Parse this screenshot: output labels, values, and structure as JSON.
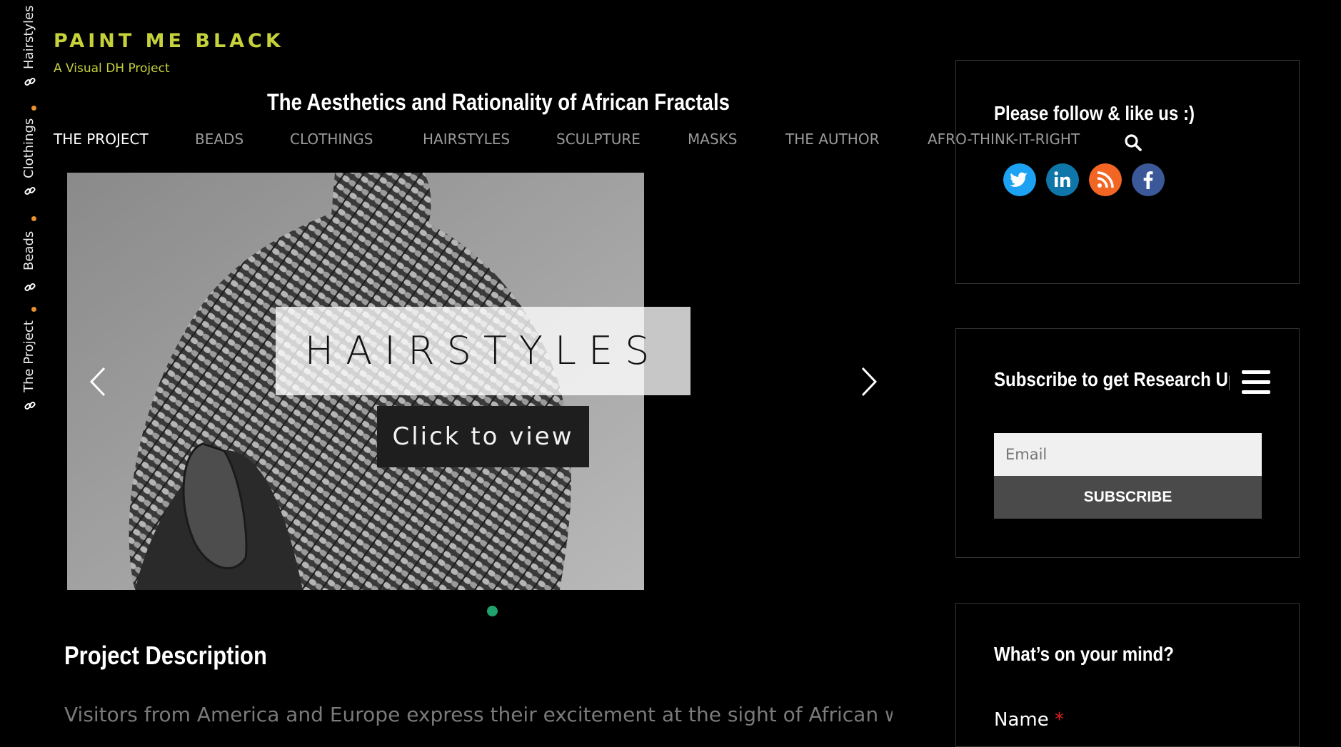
{
  "site": {
    "title": "PAINT ME BLACK",
    "tagline": "A Visual DH Project",
    "headline": "The Aesthetics and Rationality of African Fractals"
  },
  "side_nav": [
    "Hairstyles",
    "Clothings",
    "Beads",
    "The Project"
  ],
  "main_nav": [
    {
      "label": "THE PROJECT",
      "active": true
    },
    {
      "label": "BEADS"
    },
    {
      "label": "CLOTHINGS"
    },
    {
      "label": "HAIRSTYLES"
    },
    {
      "label": "SCULPTURE"
    },
    {
      "label": "MASKS"
    },
    {
      "label": "THE AUTHOR"
    },
    {
      "label": "AFRO-THINK-IT-RIGHT"
    }
  ],
  "slider": {
    "caption": "HAIRSTYLES",
    "cta": "Click to view",
    "active_slide": 1,
    "slide_count": 1
  },
  "section": {
    "title": "Project Description",
    "text": "Visitors from America and Europe express their excitement at the sight of African woven and"
  },
  "sidebar": {
    "follow_title": "Please follow & like us :)",
    "social": [
      {
        "icon": "twitter-icon",
        "color": "#1da1f2"
      },
      {
        "icon": "linkedin-icon",
        "color": "#0e76a8"
      },
      {
        "icon": "rss-icon",
        "color": "#f26522"
      },
      {
        "icon": "facebook-icon",
        "color": "#3b5998"
      }
    ],
    "subscribe_title": "Subscribe to get Research Updates",
    "email_placeholder": "Email",
    "subscribe_button": "SUBSCRIBE",
    "mind_title": "What’s on your mind?",
    "name_label": "Name",
    "required_mark": "*"
  },
  "colors": {
    "brand": "#c6d23a",
    "accent_dot": "#e8912d",
    "slider_dot": "#1fa26b"
  }
}
